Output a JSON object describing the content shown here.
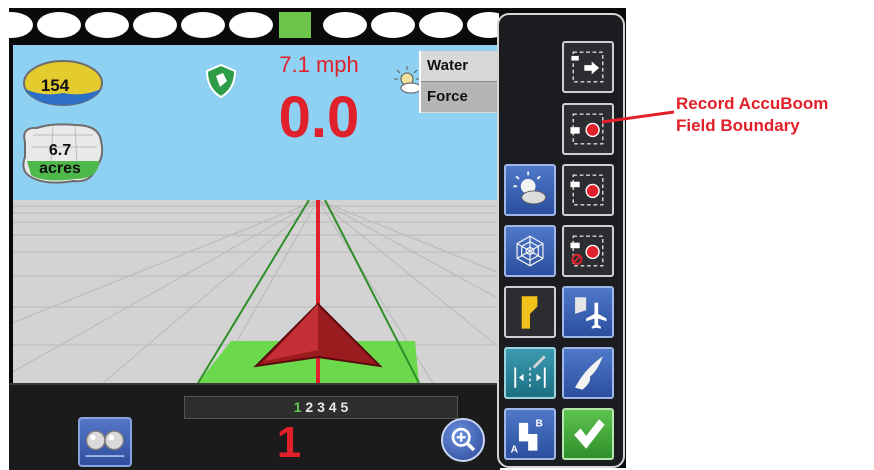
{
  "app": {
    "gps_count": "154",
    "area_value": "6.7",
    "area_unit": "acres",
    "speed_label": "7.1 mph",
    "speed_value": "0.0",
    "water_label": "Water",
    "force_label": "Force",
    "current_row": "1"
  },
  "lanes": {
    "active": "1",
    "rest": " 2 3 4 5"
  },
  "toolbar": {
    "buttons": [
      {
        "name": "import-boundary-button",
        "icon": "import-boundary-icon"
      },
      {
        "name": "record-accuboom-boundary-button",
        "icon": "record-boundary-icon"
      },
      {
        "name": "day-night-button",
        "icon": "sun-cloud-icon"
      },
      {
        "name": "record-boundary-button",
        "icon": "record-boundary-icon"
      },
      {
        "name": "guidance-pattern-button",
        "icon": "spiderweb-icon"
      },
      {
        "name": "cancel-record-boundary-button",
        "icon": "cancel-record-icon"
      },
      {
        "name": "mark-flag-button",
        "icon": "flag-icon"
      },
      {
        "name": "aerial-view-button",
        "icon": "plane-icon"
      },
      {
        "name": "swath-width-button",
        "icon": "swath-icon"
      },
      {
        "name": "freeform-pattern-button",
        "icon": "bird-icon"
      },
      {
        "name": "ab-line-button",
        "icon": "ab-line-icon"
      },
      {
        "name": "confirm-button",
        "icon": "checkmark-icon"
      }
    ]
  },
  "callout": {
    "line1": "Record AccuBoom",
    "line2": "Field Boundary"
  },
  "colors": {
    "sky": "#8fd1f2",
    "ground": "#d3d3d3",
    "swath": "#6cd84c",
    "alert_red": "#e0202a",
    "panel": "#1b1c1f"
  }
}
